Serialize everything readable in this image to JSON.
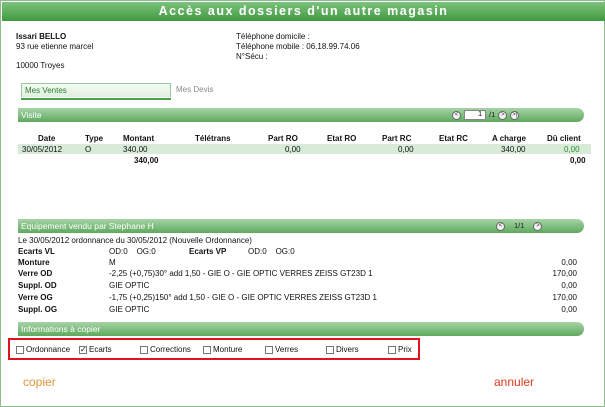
{
  "title": "Accès aux dossiers d'un autre magasin",
  "client": {
    "name": "Issari BELLO",
    "address": "93 rue etienne marcel",
    "city": "10000 Troyes",
    "phone_home": "Téléphone domicile :",
    "phone_mobile": "Téléphone mobile : 06.18.99.74.06",
    "secu": "N°Sécu :"
  },
  "tabs": {
    "active": "Mes Ventes",
    "inactive": "Mes Devis"
  },
  "visite": {
    "title": "Visite",
    "pager": {
      "prev": "<",
      "page": "1",
      "total": "/1",
      "next": ">",
      "last": ">|"
    },
    "headers": [
      "Date",
      "Type",
      "Montant",
      "Télétrans",
      "Part RO",
      "Etat RO",
      "Part RC",
      "Etat RC",
      "A charge",
      "Dû client"
    ],
    "row": [
      "30/05/2012",
      "O",
      "340,00",
      "",
      "0,00",
      "",
      "0,00",
      "",
      "340,00",
      "0,00"
    ],
    "total_montant": "340,00",
    "total_du": "0,00"
  },
  "equipement": {
    "title": "Equipement vendu par Stephane H",
    "pager": {
      "prev": "<",
      "text": "1/1",
      "next": ">"
    },
    "ordonnance": "Le 30/05/2012 ordonnance du 30/05/2012 (Nouvelle Ordonnance)",
    "ecarts_vl_label": "Ecarts VL",
    "ecarts_vl_value": "OD:0    OG:0",
    "ecarts_vp_label": "Ecarts VP",
    "ecarts_vp_value": "OD:0    OG:0",
    "lines": [
      {
        "label": "Monture",
        "desc": "M",
        "price": "0,00"
      },
      {
        "label": "Verre OD",
        "desc": "-2,25 (+0,75)30° add 1,50 - GIE O - GIE OPTIC VERRES ZEISS GT23D 1",
        "price": "170,00"
      },
      {
        "label": "Suppl. OD",
        "desc": "GIE OPTIC",
        "price": "0,00"
      },
      {
        "label": "Verre OG",
        "desc": "-1,75 (+0,25)150° add 1,50 - GIE O - GIE OPTIC VERRES ZEISS GT23D 1",
        "price": "170,00"
      },
      {
        "label": "Suppl. OG",
        "desc": "GIE OPTIC",
        "price": "0,00"
      }
    ]
  },
  "copier_section": {
    "title": "Informations à copier",
    "options": [
      {
        "label": "Ordonnance",
        "checked": false
      },
      {
        "label": "Ecarts",
        "checked": true
      },
      {
        "label": "Corrections",
        "checked": false
      },
      {
        "label": "Monture",
        "checked": false
      },
      {
        "label": "Verres",
        "checked": false
      },
      {
        "label": "Divers",
        "checked": false
      },
      {
        "label": "Prix",
        "checked": false
      }
    ],
    "check_mark": "✓"
  },
  "buttons": {
    "copy": "copier",
    "cancel": "annuler"
  },
  "colors": {
    "accent_green": "#4aa04a",
    "highlight_red": "#e0141e",
    "copy_orange": "#e09438",
    "cancel_red": "#d93a1a"
  }
}
